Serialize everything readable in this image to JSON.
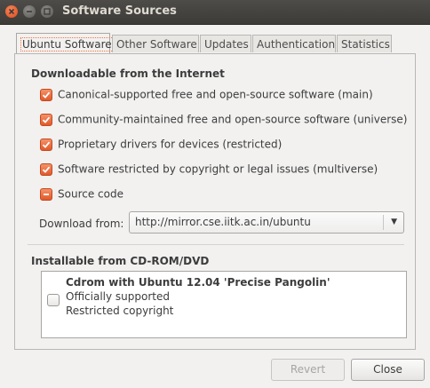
{
  "window": {
    "title": "Software Sources",
    "buttons": [
      "close-icon",
      "minimize-icon",
      "maximize-icon"
    ]
  },
  "tabs": [
    {
      "label": "Ubuntu Software",
      "active": true
    },
    {
      "label": "Other Software",
      "active": false
    },
    {
      "label": "Updates",
      "active": false
    },
    {
      "label": "Authentication",
      "active": false
    },
    {
      "label": "Statistics",
      "active": false
    }
  ],
  "internet": {
    "heading": "Downloadable from the Internet",
    "items": [
      {
        "label": "Canonical-supported free and open-source software (main)",
        "state": "checked"
      },
      {
        "label": "Community-maintained free and open-source software (universe)",
        "state": "checked"
      },
      {
        "label": "Proprietary drivers for devices (restricted)",
        "state": "checked"
      },
      {
        "label": "Software restricted by copyright or legal issues (multiverse)",
        "state": "checked"
      },
      {
        "label": "Source code",
        "state": "indeterminate"
      }
    ],
    "download_from_label": "Download from:",
    "download_from_value": "http://mirror.cse.iitk.ac.in/ubuntu"
  },
  "cdrom": {
    "heading": "Installable from CD-ROM/DVD",
    "item": {
      "title": "Cdrom with Ubuntu 12.04 'Precise Pangolin'",
      "line1": "Officially supported",
      "line2": "Restricted copyright",
      "checked": false
    }
  },
  "footer": {
    "revert_label": "Revert",
    "close_label": "Close"
  },
  "colors": {
    "accent": "#e0592a",
    "titlebar": "#3c3b37",
    "background": "#f2f1f0"
  }
}
